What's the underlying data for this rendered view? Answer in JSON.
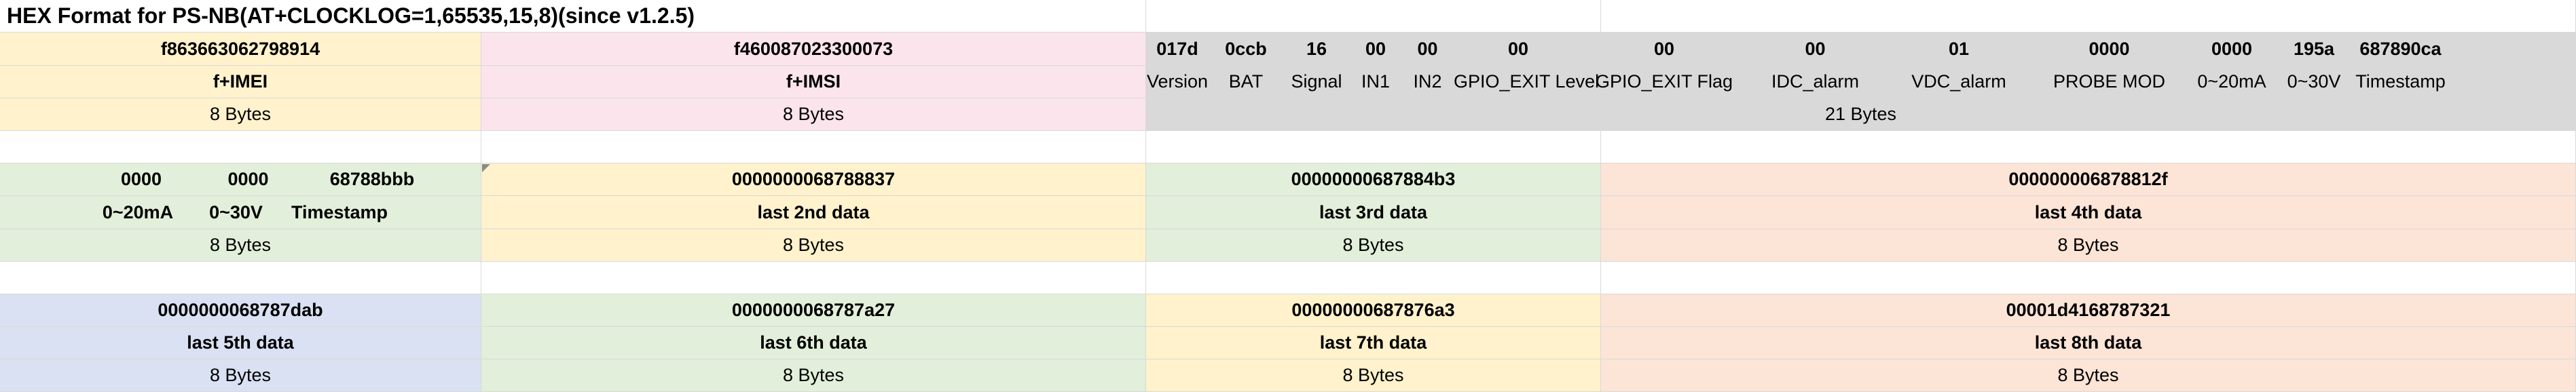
{
  "title": "HEX Format for PS-NB(AT+CLOCKLOG=1,65535,15,8)(since v1.2.5)",
  "row1": {
    "imei_hex": "f863663062798914",
    "imei_label": "f+IMEI",
    "imei_size": "8 Bytes",
    "imsi_hex": "f460087023300073",
    "imsi_label": "f+IMSI",
    "imsi_size": "8 Bytes",
    "fields": [
      {
        "hex": "017d",
        "label": "Version"
      },
      {
        "hex": "0ccb",
        "label": "BAT"
      },
      {
        "hex": "16",
        "label": "Signal"
      },
      {
        "hex": "00",
        "label": "IN1"
      },
      {
        "hex": "00",
        "label": "IN2"
      },
      {
        "hex": "00",
        "label": "GPIO_EXIT Level"
      },
      {
        "hex": "00",
        "label": "GPIO_EXIT Flag"
      },
      {
        "hex": "00",
        "label": "IDC_alarm"
      },
      {
        "hex": "01",
        "label": "VDC_alarm"
      },
      {
        "hex": "0000",
        "label": "PROBE MOD"
      },
      {
        "hex": "0000",
        "label": "0~20mA"
      },
      {
        "hex": "195a",
        "label": "0~30V"
      },
      {
        "hex": "687890ca",
        "label": "Timestamp"
      }
    ],
    "fields_size": "21 Bytes"
  },
  "row2": {
    "first": {
      "hex": [
        "0000",
        "0000",
        "68788bbb"
      ],
      "labels": [
        "0~20mA",
        "0~30V",
        "Timestamp"
      ],
      "size": "8 Bytes"
    },
    "second": {
      "hex": "0000000068788837",
      "label": "last 2nd data",
      "size": "8 Bytes"
    },
    "third": {
      "hex": "00000000687884b3",
      "label": "last 3rd data",
      "size": "8 Bytes"
    },
    "fourth": {
      "hex": "000000006878812f",
      "label": "last 4th data",
      "size": "8 Bytes"
    }
  },
  "row3": {
    "fifth": {
      "hex": "0000000068787dab",
      "label": "last 5th data",
      "size": "8 Bytes"
    },
    "sixth": {
      "hex": "0000000068787a27",
      "label": "last 6th data",
      "size": "8 Bytes"
    },
    "seventh": {
      "hex": "00000000687876a3",
      "label": "last 7th data",
      "size": "8 Bytes"
    },
    "eighth": {
      "hex": "00001d4168787321",
      "label": "last 8th data",
      "size": "8 Bytes"
    }
  }
}
